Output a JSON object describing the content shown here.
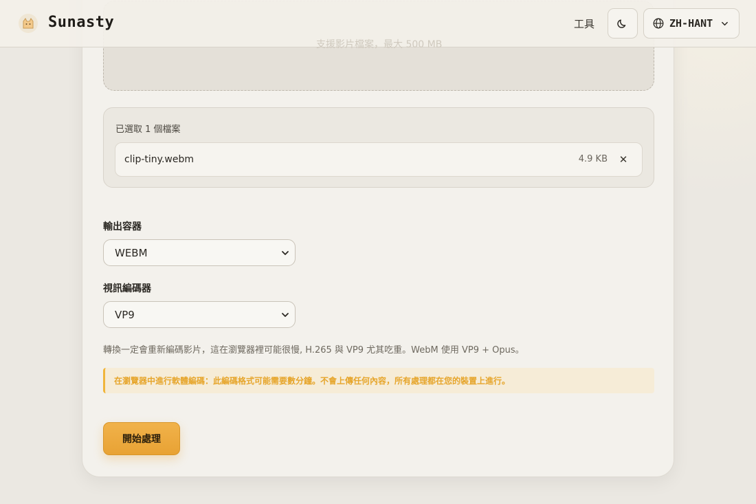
{
  "header": {
    "brand": "Sunasty",
    "tools_label": "工具",
    "language": "ZH-HANT",
    "icons": [
      "cat-logo-icon",
      "moon-icon",
      "globe-icon",
      "chevron-down-icon"
    ]
  },
  "dropzone": {
    "hint": "支援影片檔案，最大 500 MB"
  },
  "files": {
    "count_label": "已選取 1 個檔案",
    "items": [
      {
        "name": "clip-tiny.webm",
        "size": "4.9 KB"
      }
    ],
    "remove_glyph": "✕"
  },
  "container": {
    "label": "輸出容器",
    "value": "WEBM"
  },
  "codec": {
    "label": "視訊編碼器",
    "value": "VP9"
  },
  "note": "轉換一定會重新編碼影片，這在瀏覽器裡可能很慢, H.265 與 VP9 尤其吃重。WebM 使用 VP9 + Opus。",
  "warning": "在瀏覽器中進行軟體編碼：此編碼格式可能需要數分鐘。不會上傳任何內容，所有處理都在您的裝置上進行。",
  "start_button": "開始處理",
  "colors": {
    "accent": "#e8a234",
    "warning_text": "#e6a52b",
    "warning_bg": "#f6ecd7",
    "card_bg": "#f3f1ec",
    "page_bg": "#ebe8e2"
  }
}
